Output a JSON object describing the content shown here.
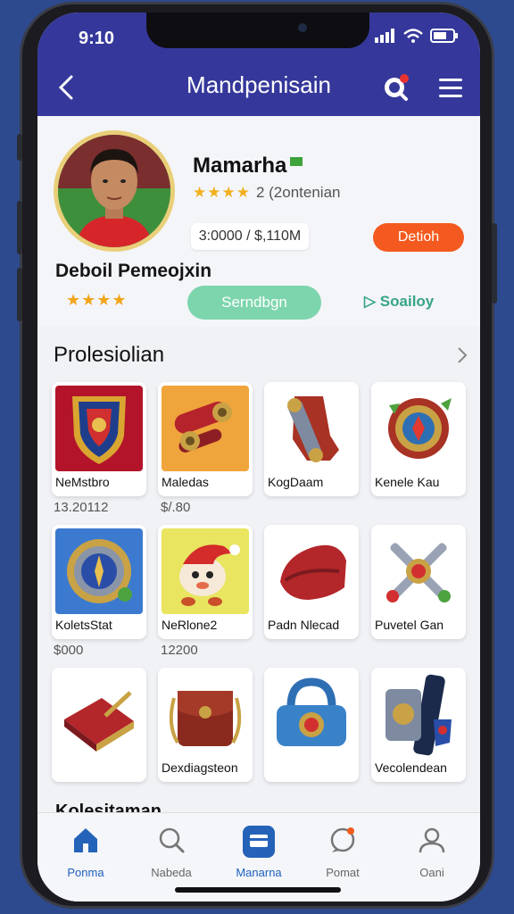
{
  "status_bar": {
    "time": "9:10"
  },
  "header": {
    "back_icon": "chevron-left-icon",
    "title": "Mandpenisain",
    "search_icon": "search-icon",
    "menu_icon": "hamburger-menu-icon"
  },
  "profile": {
    "name": "Mamarha",
    "stars": "★★★★",
    "rating_text": "2 (2ontenian",
    "price": "3:0000 / $,110M",
    "detail_button": "Detioh",
    "subtitle": "Deboil Pemeojxin",
    "stars2": "★★★★",
    "green_button": "Serndbgn",
    "play_link": "▷ Soailoy"
  },
  "section": {
    "title": "Prolesiolian",
    "more_icon": "chevron-right-icon"
  },
  "items": [
    {
      "label": "NeMstbro",
      "price": "13.20112"
    },
    {
      "label": "Maledas",
      "price": "$/.80"
    },
    {
      "label": "KogDaam",
      "price": ""
    },
    {
      "label": "Kenele Kau",
      "price": ""
    },
    {
      "label": "KoletsStat",
      "price": "$000"
    },
    {
      "label": "NeRlone2",
      "price": "12200"
    },
    {
      "label": "Padn Nlecad",
      "price": ""
    },
    {
      "label": "Puvetel Gan",
      "price": ""
    },
    {
      "label": "",
      "price": ""
    },
    {
      "label": "Dexdiagsteon",
      "price": ""
    },
    {
      "label": "",
      "price": ""
    },
    {
      "label": "Vecolendean",
      "price": ""
    }
  ],
  "footer_section": "Kolesitaman",
  "tabs": [
    {
      "label": "Ponma",
      "icon": "home-icon"
    },
    {
      "label": "Nabeda",
      "icon": "search-icon"
    },
    {
      "label": "Manarna",
      "icon": "wallet-icon"
    },
    {
      "label": "Pomat",
      "icon": "chat-icon"
    },
    {
      "label": "Oani",
      "icon": "user-icon"
    }
  ]
}
